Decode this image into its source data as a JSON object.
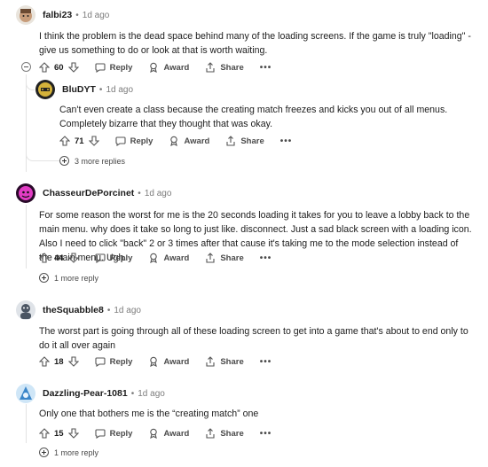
{
  "comments": [
    {
      "author": "falbi23",
      "time": "1d ago",
      "body": "I think the problem is the dead space behind many of the loading screens. If the game is truly \"loading\" - give us something to do or look at that is worth waiting.",
      "votes": "60",
      "reply": "Reply",
      "award": "Award",
      "share": "Share"
    },
    {
      "author": "BluDYT",
      "time": "1d ago",
      "body": "Can't even create a class because the creating match freezes and kicks you out of all menus. Completely bizarre that they thought that was okay.",
      "votes": "71",
      "reply": "Reply",
      "award": "Award",
      "share": "Share",
      "more_replies": "3 more replies"
    },
    {
      "author": "ChasseurDePorcinet",
      "time": "1d ago",
      "body": "For some reason the worst for me is the 20 seconds loading it takes for you to leave a lobby back to the main menu. why does it take so long to just like. disconnect. Just a sad black screen with a loading icon. Also I need to click \"back\" 2 or 3 times after that cause it's taking me to the mode selection instead of the main menu. Ugh.",
      "votes": "44",
      "reply": "Reply",
      "award": "Award",
      "share": "Share",
      "more_replies": "1 more reply"
    },
    {
      "author": "theSquabble8",
      "time": "1d ago",
      "body": "The worst part is going through all of these loading screen to get into a game that's about to end only to do it all over again",
      "votes": "18",
      "reply": "Reply",
      "award": "Award",
      "share": "Share"
    },
    {
      "author": "Dazzling-Pear-1081",
      "time": "1d ago",
      "body": "Only one that bothers me is the “creating match” one",
      "votes": "15",
      "reply": "Reply",
      "award": "Award",
      "share": "Share",
      "more_replies": "1 more reply"
    }
  ],
  "separator": "•",
  "more_menu": "•••",
  "colors": {
    "text": "#1c1c1c",
    "meta": "#7c7c7c",
    "thread_line": "#e3e3e3"
  }
}
